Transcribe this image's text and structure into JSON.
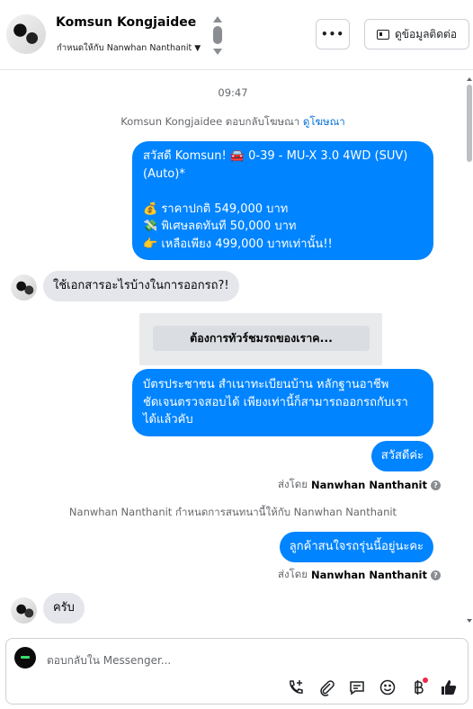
{
  "header": {
    "contact_name": "Komsun Kongjaidee",
    "assigned_to": "กำหนดให้กับ Nanwhan Nanthanit",
    "more_label": "•••",
    "contact_info_label": "ดูข้อมูลติดต่อ"
  },
  "chat": {
    "timestamp": "09:47",
    "ad_reply_text": "Komsun Kongjaidee ตอบกลับโฆษณา",
    "ad_reply_link": "ดูโฆษณา",
    "messages": [
      {
        "lines": [
          "สวัสดี Komsun! 🚘 0-39 - MU-X 3.0 4WD (SUV)",
          "(Auto)*",
          "",
          "💰 ราคาปกติ 549,000 บาท",
          "💸 พิเศษลดทันที 50,000 บาท",
          "👉 เหลือเพียง 499,000 บาทเท่านั้น!!"
        ]
      },
      {
        "text": "ใช้เอกสารอะไรบ้างในการออกรถ?!"
      },
      {
        "template_button": "ต้องการทัวร์ชมรถของเราค..."
      },
      {
        "lines": [
          "บัตรประชาชน สำเนาทะเบียนบ้าน หลักฐานอาชีพ",
          "ชัดเจนตรวจสอบได้ เพียงเท่านี้ก็สามารถออกรถกับเรา",
          "ได้แล้วคับ"
        ]
      },
      {
        "text": "สวัสดีค่ะ"
      },
      {
        "sent_by_prefix": "ส่งโดย",
        "sent_by_name": "Nanwhan Nanthanit"
      },
      {
        "system": "Nanwhan Nanthanit กำหนดการสนทนานี้ให้กับ Nanwhan Nanthanit"
      },
      {
        "text": "ลูกค้าสนใจรถรุ่นนี้อยู่นะคะ"
      },
      {
        "sent_by_prefix": "ส่งโดย",
        "sent_by_name": "Nanwhan Nanthanit"
      },
      {
        "text": "ครับ"
      }
    ]
  },
  "composer": {
    "placeholder": "ตอบกลับใน Messenger...",
    "icons": [
      "add-call-icon",
      "attachment-icon",
      "saved-replies-icon",
      "emoji-icon",
      "payment-icon",
      "like-icon"
    ]
  },
  "colors": {
    "outgoing_bubble": "#0084ff",
    "incoming_bubble": "#e4e6eb",
    "link": "#0571d6"
  }
}
